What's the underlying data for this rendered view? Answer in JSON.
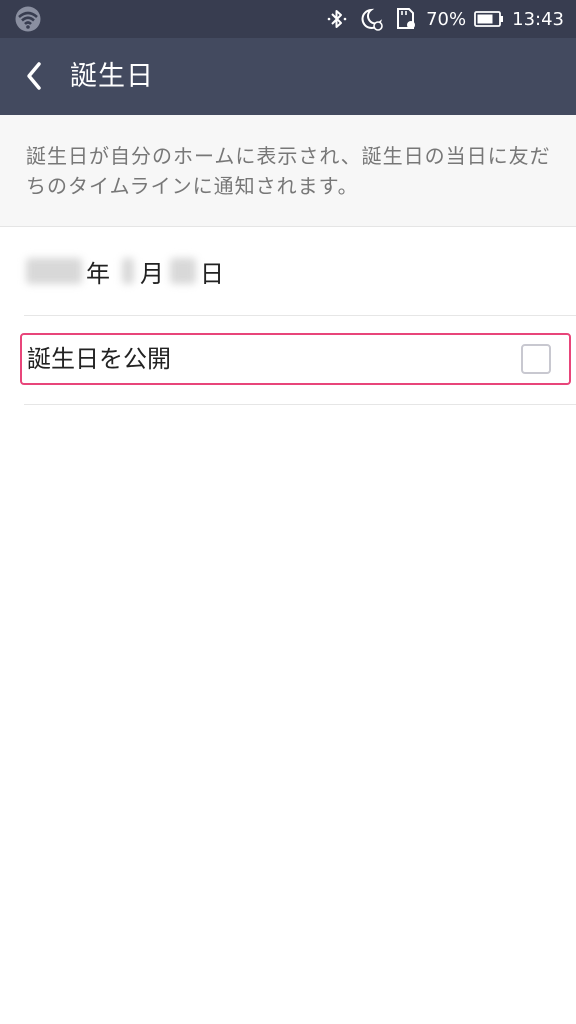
{
  "status_bar": {
    "battery": "70%",
    "time": "13:43",
    "icons": [
      "wifi-icon",
      "bluetooth-icon",
      "night-alarm-icon",
      "sd-card-icon",
      "battery-icon"
    ]
  },
  "app_bar": {
    "title": "誕生日",
    "back_icon": "chevron-left-icon"
  },
  "info": {
    "text": "誕生日が自分のホームに表示され、誕生日の当日に友だちのタイムラインに通知されます。"
  },
  "birthday": {
    "year_suffix": "年",
    "month_suffix": "月",
    "day_suffix": "日"
  },
  "publish": {
    "label": "誕生日を公開",
    "checked": false
  },
  "colors": {
    "status_bar": "#383d50",
    "app_bar": "#434a5f",
    "highlight": "#e8457a"
  }
}
